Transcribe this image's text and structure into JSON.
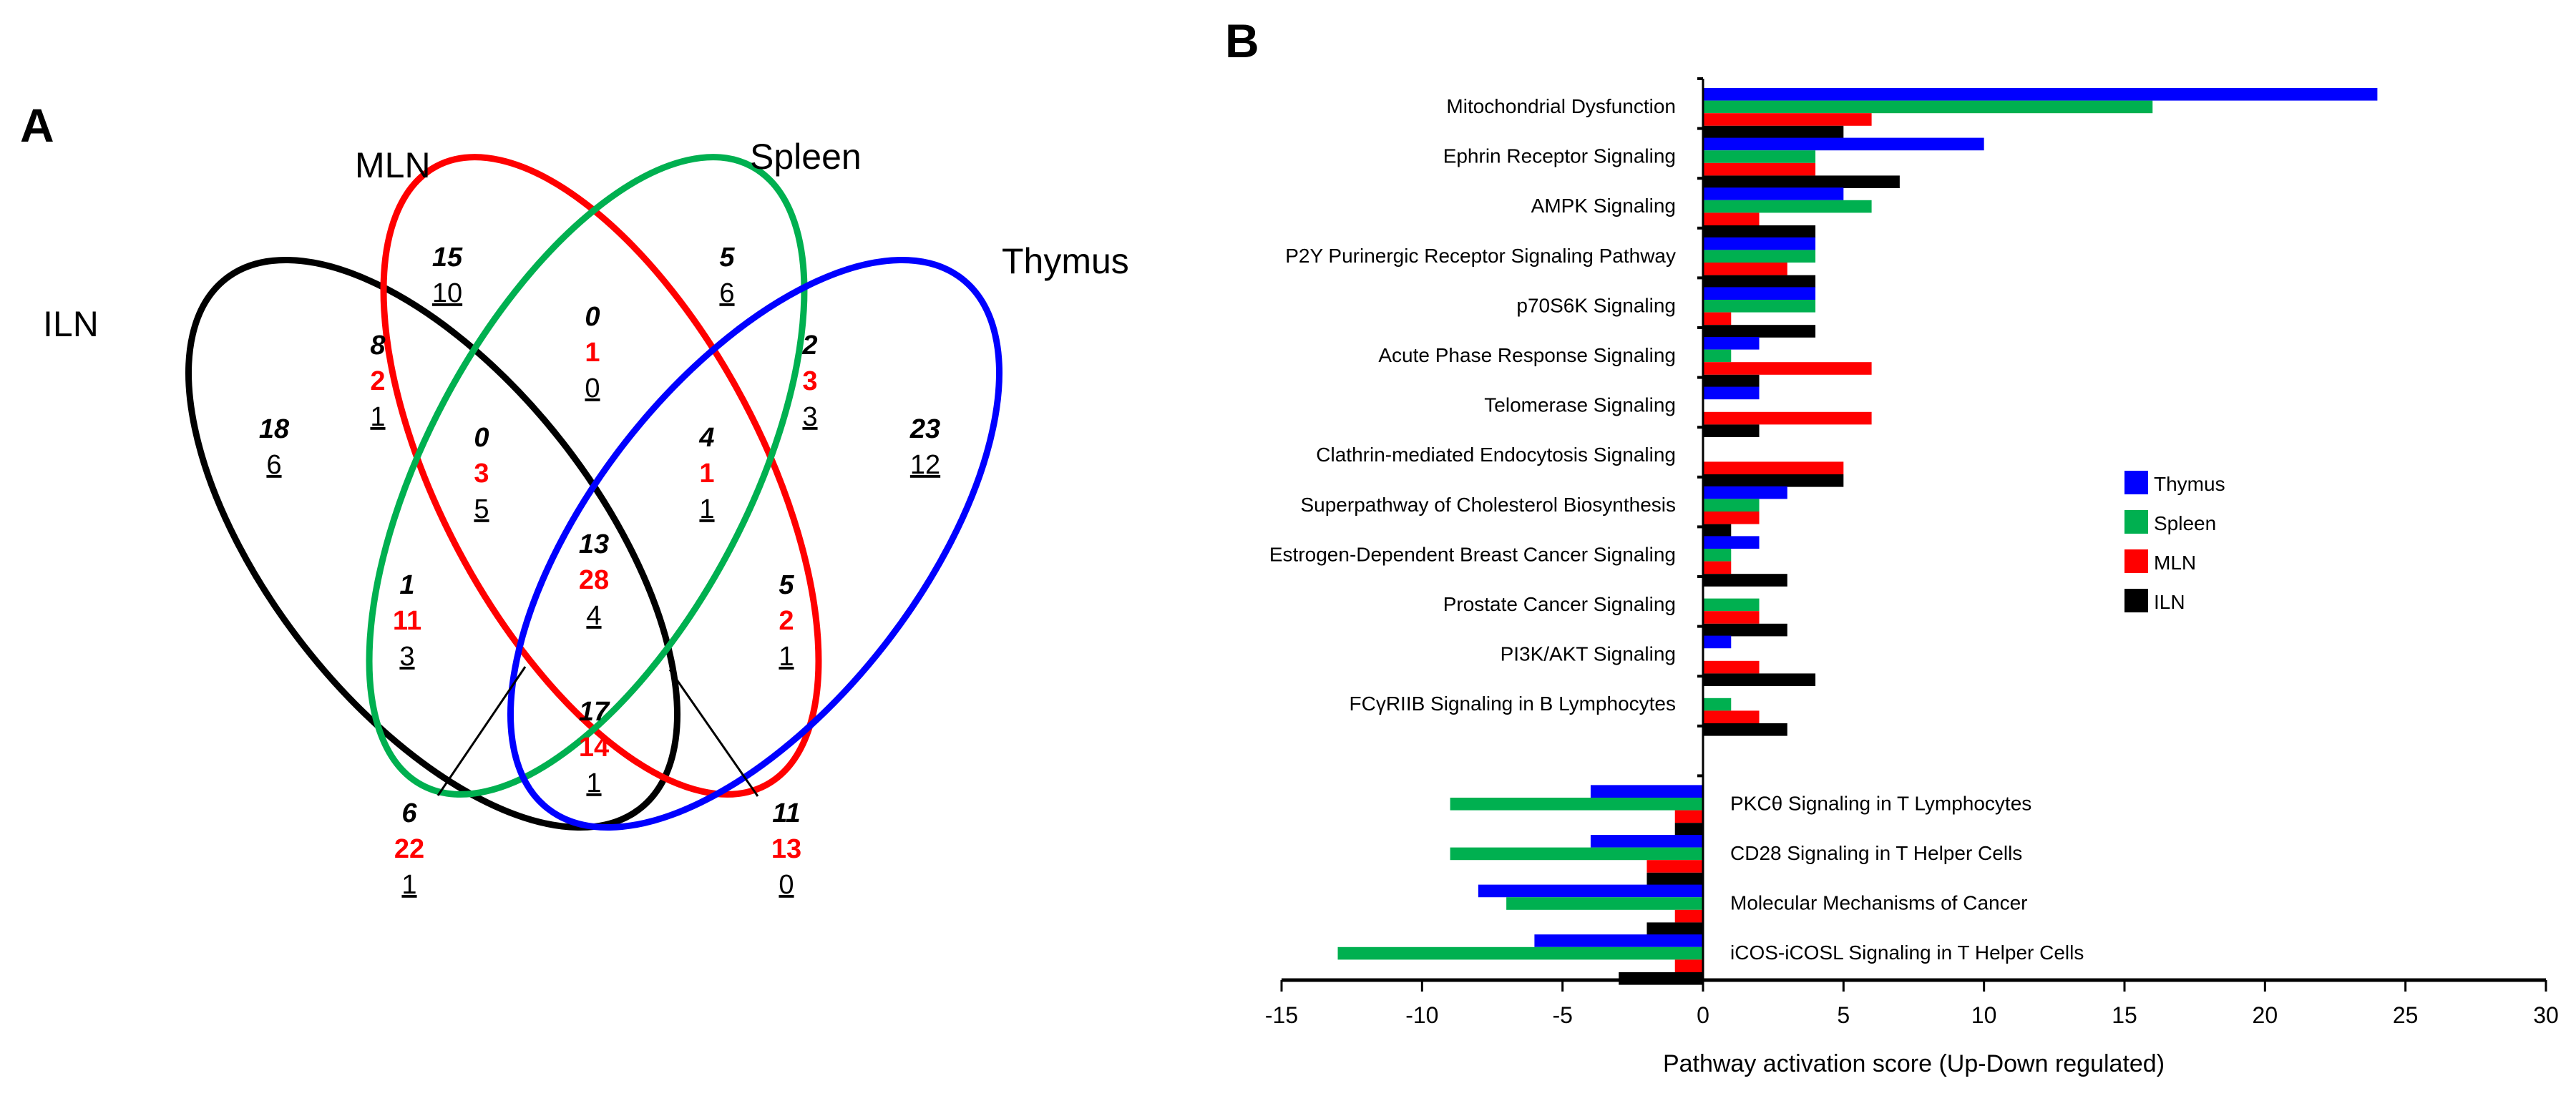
{
  "panel_a": {
    "letter": "A",
    "sets": [
      {
        "key": "ILN",
        "label": "ILN",
        "color": "#000000"
      },
      {
        "key": "MLN",
        "label": "MLN",
        "color": "#ff0000"
      },
      {
        "key": "Spleen",
        "label": "Spleen",
        "color": "#00b050"
      },
      {
        "key": "Thymus",
        "label": "Thymus",
        "color": "#0000ff"
      }
    ],
    "regions": [
      {
        "id": "ILN-only",
        "italic": "18",
        "red": "",
        "underline": "6"
      },
      {
        "id": "MLN-only",
        "italic": "15",
        "red": "",
        "underline": "10"
      },
      {
        "id": "Spleen-only",
        "italic": "5",
        "red": "",
        "underline": "6"
      },
      {
        "id": "Thymus-only",
        "italic": "23",
        "red": "",
        "underline": "12"
      },
      {
        "id": "ILN-MLN",
        "italic": "8",
        "red": "2",
        "underline": "1"
      },
      {
        "id": "MLN-Spleen",
        "italic": "0",
        "red": "1",
        "underline": "0"
      },
      {
        "id": "Spleen-Thymus",
        "italic": "2",
        "red": "3",
        "underline": "3"
      },
      {
        "id": "ILN-MLN-Spleen",
        "italic": "0",
        "red": "3",
        "underline": "5"
      },
      {
        "id": "MLN-Spleen-Thymus",
        "italic": "4",
        "red": "1",
        "underline": "1"
      },
      {
        "id": "ILN-Spleen",
        "italic": "1",
        "red": "11",
        "underline": "3"
      },
      {
        "id": "all-four",
        "italic": "13",
        "red": "28",
        "underline": "4"
      },
      {
        "id": "MLN-Thymus",
        "italic": "5",
        "red": "2",
        "underline": "1"
      },
      {
        "id": "ILN-Thymus",
        "italic": "17",
        "red": "14",
        "underline": "1"
      },
      {
        "id": "ILN-Spleen-Thymus",
        "italic": "6",
        "red": "22",
        "underline": "1"
      },
      {
        "id": "ILN-MLN-Thymus",
        "italic": "11",
        "red": "13",
        "underline": "0"
      }
    ]
  },
  "panel_b": {
    "letter": "B"
  },
  "chart_data": {
    "type": "bar",
    "orientation": "horizontal",
    "title": "",
    "xlabel": "Pathway activation score (Up-Down regulated)",
    "ylabel": "",
    "xlim": [
      -15,
      30
    ],
    "xticks": [
      -15,
      -10,
      -5,
      0,
      5,
      10,
      15,
      20,
      25,
      30
    ],
    "grid": false,
    "legend_position": "right-middle",
    "categories": [
      "Mitochondrial Dysfunction",
      "Ephrin Receptor Signaling",
      "AMPK Signaling",
      "P2Y Purinergic Receptor Signaling Pathway",
      "p70S6K Signaling",
      "Acute Phase Response Signaling",
      "Telomerase Signaling",
      "Clathrin-mediated Endocytosis Signaling",
      "Superpathway of Cholesterol Biosynthesis",
      "Estrogen-Dependent Breast Cancer Signaling",
      "Prostate Cancer Signaling",
      "PI3K/AKT Signaling",
      "FCγRIIB Signaling in B Lymphocytes",
      "",
      "PKCθ Signaling in T Lymphocytes",
      "CD28 Signaling in T Helper Cells",
      "Molecular Mechanisms of Cancer",
      "iCOS-iCOSL Signaling in T Helper Cells"
    ],
    "series": [
      {
        "name": "Thymus",
        "color": "#0000ff",
        "values": [
          24,
          10,
          5,
          4,
          4,
          2,
          2,
          0,
          3,
          2,
          0,
          1,
          0,
          0,
          -4,
          -4,
          -8,
          -6
        ]
      },
      {
        "name": "Spleen",
        "color": "#00b050",
        "values": [
          16,
          4,
          6,
          4,
          4,
          1,
          0,
          0,
          2,
          1,
          2,
          0,
          1,
          0,
          -9,
          -9,
          -7,
          -13
        ]
      },
      {
        "name": "MLN",
        "color": "#ff0000",
        "values": [
          6,
          4,
          2,
          3,
          1,
          6,
          6,
          5,
          2,
          1,
          2,
          2,
          2,
          0,
          -1,
          -2,
          -1,
          -1
        ]
      },
      {
        "name": "ILN",
        "color": "#000000",
        "values": [
          5,
          7,
          4,
          4,
          4,
          2,
          2,
          5,
          1,
          3,
          3,
          4,
          3,
          0,
          -1,
          -2,
          -2,
          -3
        ]
      }
    ]
  }
}
